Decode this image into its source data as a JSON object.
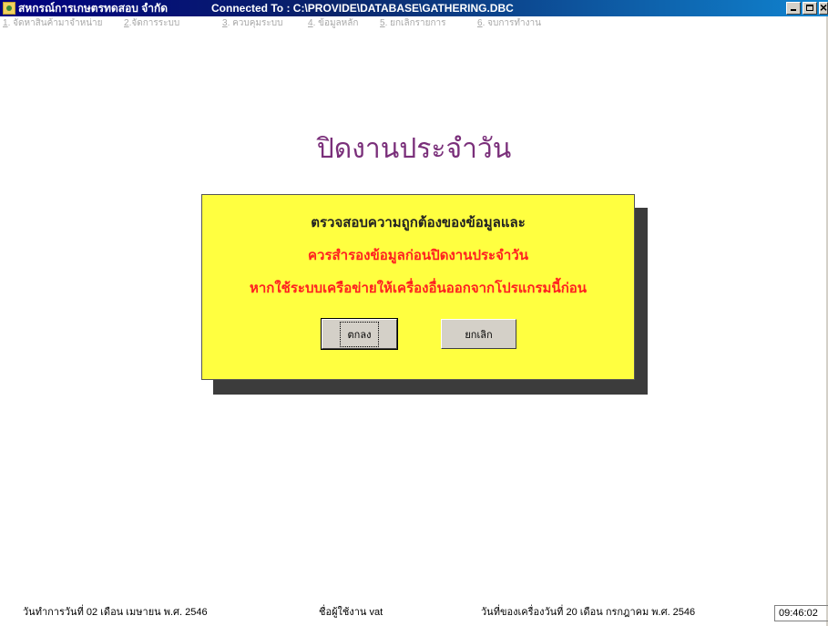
{
  "window": {
    "title": "สหกรณ์การเกษตรทดสอบ จำกัด",
    "connection": "Connected  To  : C:\\PROVIDE\\DATABASE\\GATHERING.DBC"
  },
  "menu": [
    {
      "key": "1",
      "label": ". จัดหาสินค้ามาจำหน่าย"
    },
    {
      "key": "2",
      "label": ".จัดการระบบ"
    },
    {
      "key": "3",
      "label": ". ควบคุมระบบ"
    },
    {
      "key": "4",
      "label": ". ข้อมูลหลัก"
    },
    {
      "key": "5",
      "label": ". ยกเลิกรายการ"
    },
    {
      "key": "6",
      "label": ". จบการทำงาน"
    }
  ],
  "page": {
    "title": "ปิดงานประจำวัน"
  },
  "dialog": {
    "line1": "ตรวจสอบความถูกต้องของข้อมูลและ",
    "line2": "ควรสำรองข้อมูลก่อนปิดงานประจำวัน",
    "line3": "หากใช้ระบบเครือข่ายให้เครื่องอื่นออกจากโปรแกรมนี้ก่อน",
    "ok_label": "ตกลง",
    "cancel_label": "ยกเลิก"
  },
  "status": {
    "work_date": "วันทำการวันที่ 02 เดือน เมษายน  พ.ศ. 2546",
    "user": "ชื่อผู้ใช้งาน vat",
    "machine_date": "วันที่ของเครื่องวันที่ 20 เดือน กรกฎาคม  พ.ศ. 2546",
    "clock": "09:46:02"
  }
}
